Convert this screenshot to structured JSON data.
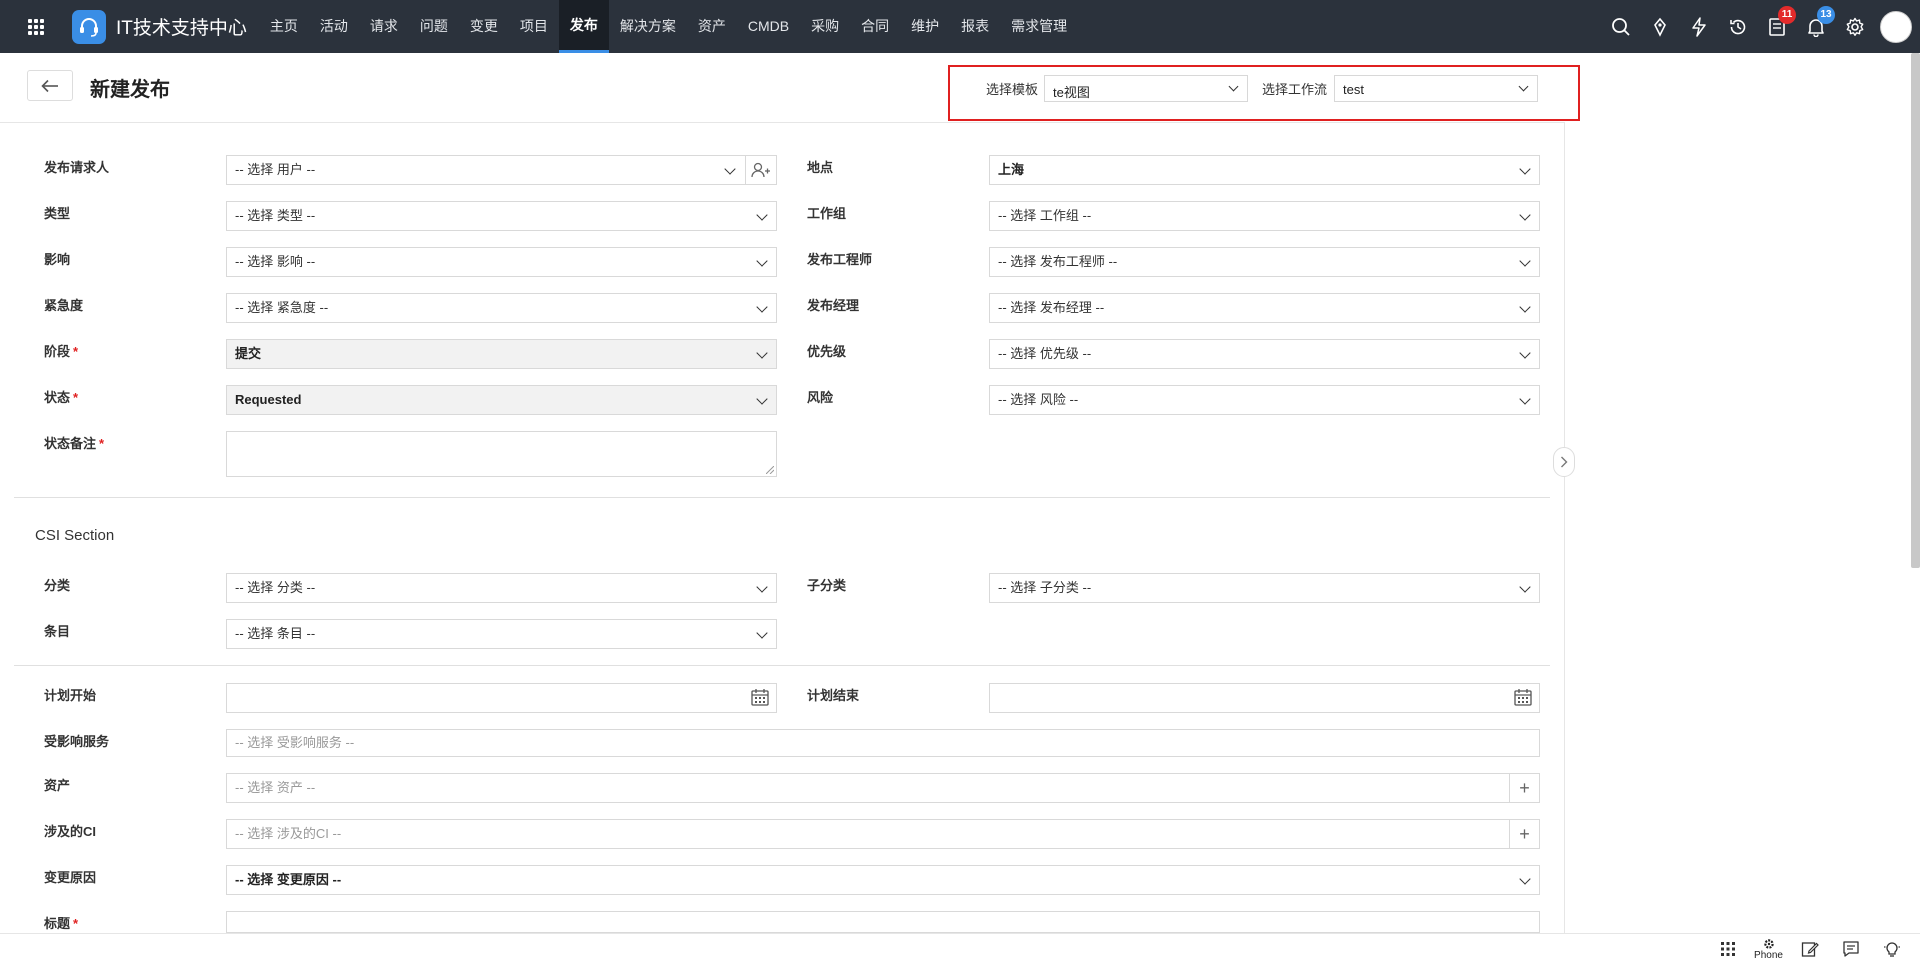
{
  "header": {
    "app_title": "IT技术支持中心",
    "nav": [
      "主页",
      "活动",
      "请求",
      "问题",
      "变更",
      "项目",
      "发布",
      "解决方案",
      "资产",
      "CMDB",
      "采购",
      "合同",
      "维护",
      "报表",
      "需求管理"
    ],
    "active_nav": "发布",
    "badges": {
      "tasks": "11",
      "notifications": "13"
    }
  },
  "page": {
    "title": "新建发布",
    "template_label": "选择模板",
    "template_value": "te视图",
    "workflow_label": "选择工作流",
    "workflow_value": "test"
  },
  "form": {
    "requester": {
      "label": "发布请求人",
      "value": "-- 选择 用户 --"
    },
    "location": {
      "label": "地点",
      "value": "上海"
    },
    "type": {
      "label": "类型",
      "value": "-- 选择 类型 --"
    },
    "group": {
      "label": "工作组",
      "value": "-- 选择 工作组 --"
    },
    "impact": {
      "label": "影响",
      "value": "-- 选择 影响 --"
    },
    "engineer": {
      "label": "发布工程师",
      "value": "-- 选择 发布工程师 --"
    },
    "urgency": {
      "label": "紧急度",
      "value": "-- 选择 紧急度 --"
    },
    "manager": {
      "label": "发布经理",
      "value": "-- 选择 发布经理 --"
    },
    "stage": {
      "label": "阶段",
      "value": "提交"
    },
    "priority": {
      "label": "优先级",
      "value": "-- 选择 优先级 --"
    },
    "status": {
      "label": "状态",
      "value": "Requested"
    },
    "risk": {
      "label": "风险",
      "value": "-- 选择 风险 --"
    },
    "status_note": {
      "label": "状态备注",
      "value": ""
    }
  },
  "csi": {
    "title": "CSI Section",
    "category": {
      "label": "分类",
      "value": "-- 选择 分类 --"
    },
    "subcategory": {
      "label": "子分类",
      "value": "-- 选择 子分类 --"
    },
    "item": {
      "label": "条目",
      "value": "-- 选择 条目 --"
    }
  },
  "schedule": {
    "plan_start": {
      "label": "计划开始",
      "value": ""
    },
    "plan_end": {
      "label": "计划结束",
      "value": ""
    },
    "services": {
      "label": "受影响服务",
      "placeholder": "-- 选择 受影响服务 --"
    },
    "assets": {
      "label": "资产",
      "placeholder": "-- 选择 资产 --"
    },
    "cis": {
      "label": "涉及的CI",
      "placeholder": "-- 选择 涉及的CI --"
    },
    "reason": {
      "label": "变更原因",
      "value": "-- 选择 变更原因 --"
    },
    "subject": {
      "label": "标题",
      "value": ""
    }
  },
  "footer": {
    "phone": "Phone"
  }
}
